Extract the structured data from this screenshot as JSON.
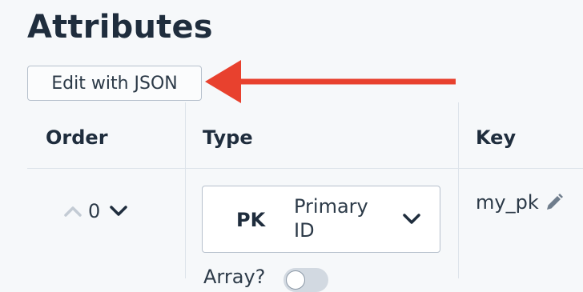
{
  "page": {
    "title": "Attributes"
  },
  "toolbar": {
    "edit_json_label": "Edit with JSON"
  },
  "table": {
    "columns": [
      "Order",
      "Type",
      "Key"
    ],
    "rows": [
      {
        "order": "0",
        "type_abbr": "PK",
        "type_name": "Primary ID",
        "array_label": "Array?",
        "array_enabled": false,
        "key": "my_pk"
      }
    ]
  },
  "icons": {
    "order_up": "chevron-up-icon",
    "order_down": "chevron-down-icon",
    "type_dropdown": "chevron-down-icon",
    "edit_key": "pencil-icon",
    "annotation": "arrow-left-icon"
  },
  "colors": {
    "annotation_arrow": "#e8412e",
    "text_primary": "#1f2d3d",
    "divider": "#dde3ea"
  }
}
